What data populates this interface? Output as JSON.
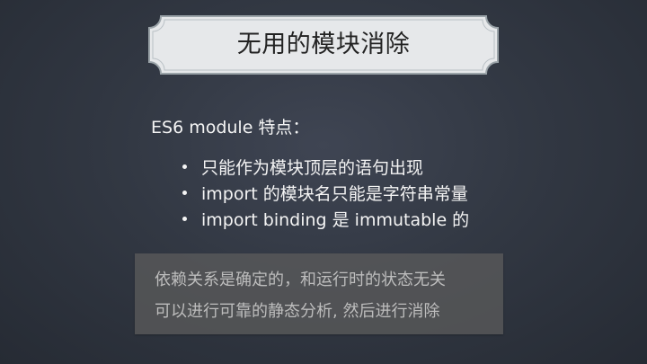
{
  "slide": {
    "title": "无用的模块消除",
    "subtitle": "ES6 module 特点：",
    "bullets": [
      "只能作为模块顶层的语句出现",
      "import 的模块名只能是字符串常量",
      "import binding 是 immutable 的"
    ],
    "note_lines": [
      "依赖关系是确定的，和运行时的状态无关",
      "可以进行可靠的静态分析, 然后进行消除"
    ]
  },
  "colors": {
    "background": "#323843",
    "plaque_fill": "#e6e8ea",
    "plaque_border": "#9aa3a8",
    "title_text": "#222222",
    "body_text": "#f4f4f4",
    "note_box": "#5c5c5c",
    "note_text": "#bdbdbd"
  }
}
